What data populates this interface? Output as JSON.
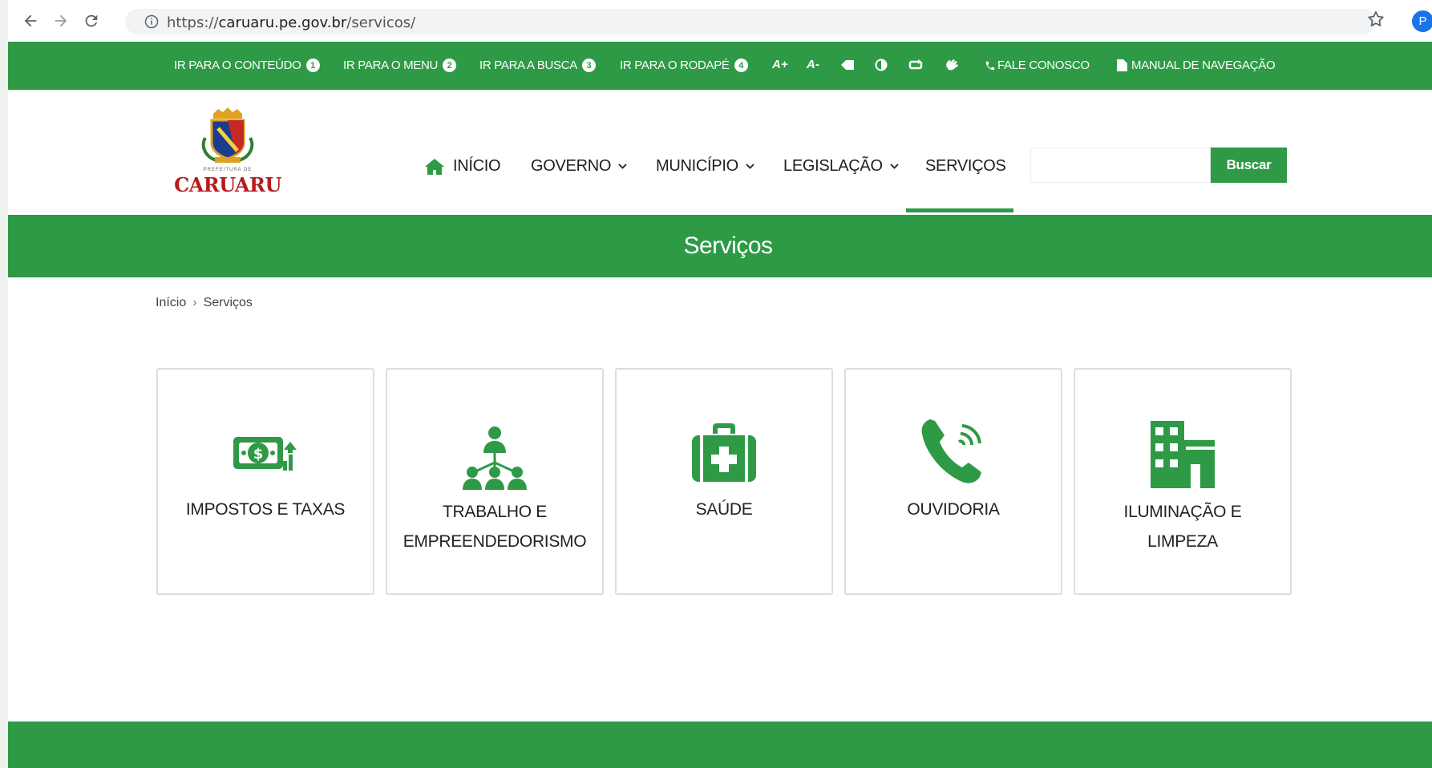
{
  "browser": {
    "url_scheme": "https://",
    "url_host": "caruaru.pe.gov.br",
    "url_path": "/servicos/",
    "profile_initial": "P"
  },
  "accessibility": {
    "links": [
      {
        "label": "IR PARA O CONTEÚDO",
        "num": "1"
      },
      {
        "label": "IR PARA O MENU",
        "num": "2"
      },
      {
        "label": "IR PARA A BUSCA",
        "num": "3"
      },
      {
        "label": "IR PARA O RODAPÉ",
        "num": "4"
      }
    ],
    "font_increase": "A+",
    "font_decrease": "A-",
    "contact": "FALE CONOSCO",
    "manual": "MANUAL DE NAVEGAÇÃO"
  },
  "logo": {
    "subtitle": "PREFEITURA DE",
    "name": "CARUARU"
  },
  "menu": {
    "home": "INÍCIO",
    "governo": "GOVERNO",
    "municipio": "MUNICÍPIO",
    "legislacao": "LEGISLAÇÃO",
    "servicos": "SERVIÇOS"
  },
  "search": {
    "placeholder": "",
    "button": "Buscar"
  },
  "page": {
    "title": "Serviços"
  },
  "breadcrumb": {
    "home": "Início",
    "separator": "›",
    "current": "Serviços"
  },
  "services": [
    {
      "line1": "IMPOSTOS E TAXAS",
      "line2": "",
      "icon": "money-icon"
    },
    {
      "line1": "TRABALHO E",
      "line2": "EMPREENDEDORISMO",
      "icon": "team-hierarchy-icon"
    },
    {
      "line1": "SAÚDE",
      "line2": "",
      "icon": "first-aid-kit-icon"
    },
    {
      "line1": "OUVIDORIA",
      "line2": "",
      "icon": "phone-icon"
    },
    {
      "line1": "ILUMINAÇÃO E",
      "line2": "LIMPEZA",
      "icon": "buildings-icon"
    }
  ],
  "colors": {
    "brand_green": "#2e9a46",
    "logo_red": "#b71c1c"
  }
}
